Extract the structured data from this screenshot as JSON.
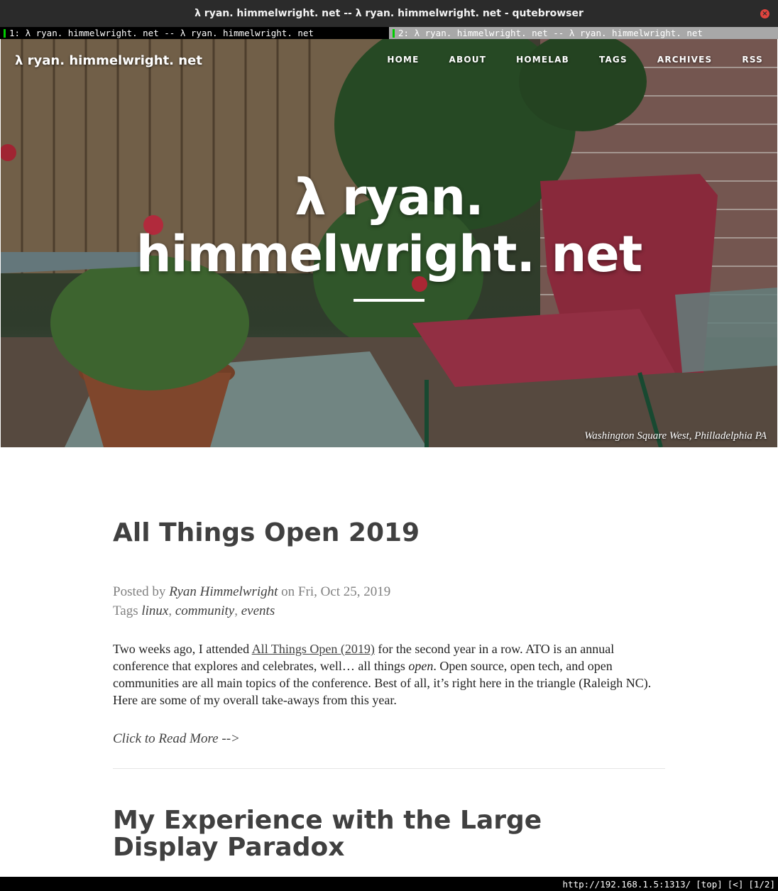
{
  "window": {
    "title": "λ ryan. himmelwright. net -- λ ryan. himmelwright. net - qutebrowser"
  },
  "tabs": [
    {
      "label": "1: λ ryan. himmelwright. net -- λ ryan. himmelwright. net",
      "active": true
    },
    {
      "label": "2: λ ryan. himmelwright. net -- λ ryan. himmelwright. net",
      "active": false
    }
  ],
  "site": {
    "brand": "λ ryan. himmelwright. net",
    "nav": [
      "HOME",
      "ABOUT",
      "HOMELAB",
      "TAGS",
      "ARCHIVES",
      "RSS"
    ],
    "hero_title_line1": "λ ryan.",
    "hero_title_line2": "himmelwright. net",
    "hero_caption": "Washington Square West, Philladelphia PA"
  },
  "posts": [
    {
      "title": "All Things Open 2019",
      "posted_by_label": "Posted by",
      "author": "Ryan Himmelwright",
      "date_text": "on Fri, Oct 25, 2019",
      "tags_label": "Tags",
      "tags": [
        "linux",
        "community",
        "events"
      ],
      "excerpt_before_link": "Two weeks ago, I attended ",
      "excerpt_link": "All Things Open (2019)",
      "excerpt_mid": " for the second year in a row. ATO is an annual conference that explores and celebrates, well… all things ",
      "excerpt_em": "open",
      "excerpt_after": ". Open source, open tech, and open communities are all main topics of the conference. Best of all, it’s right here in the triangle (Raleigh NC). Here are some of my overall take-aways from this year.",
      "read_more": "Click to Read More -->"
    },
    {
      "title": "My Experience with the Large Display Paradox"
    }
  ],
  "statusbar": {
    "url": "http://192.168.1.5:1313/",
    "scroll": "[top]",
    "history": "[<]",
    "tab_index": "[1/2]"
  },
  "colors": {
    "titlebar": "#2b2b2b",
    "tab_active": "#000000",
    "tab_inactive": "#a8a8a8",
    "tab_indicator": "#00cc00",
    "close_button": "#e0443e",
    "text_dark": "#404040",
    "text_meta": "#808080"
  },
  "icons": {
    "close": "close-icon",
    "tab_indicator": "tab-indicator-icon"
  }
}
